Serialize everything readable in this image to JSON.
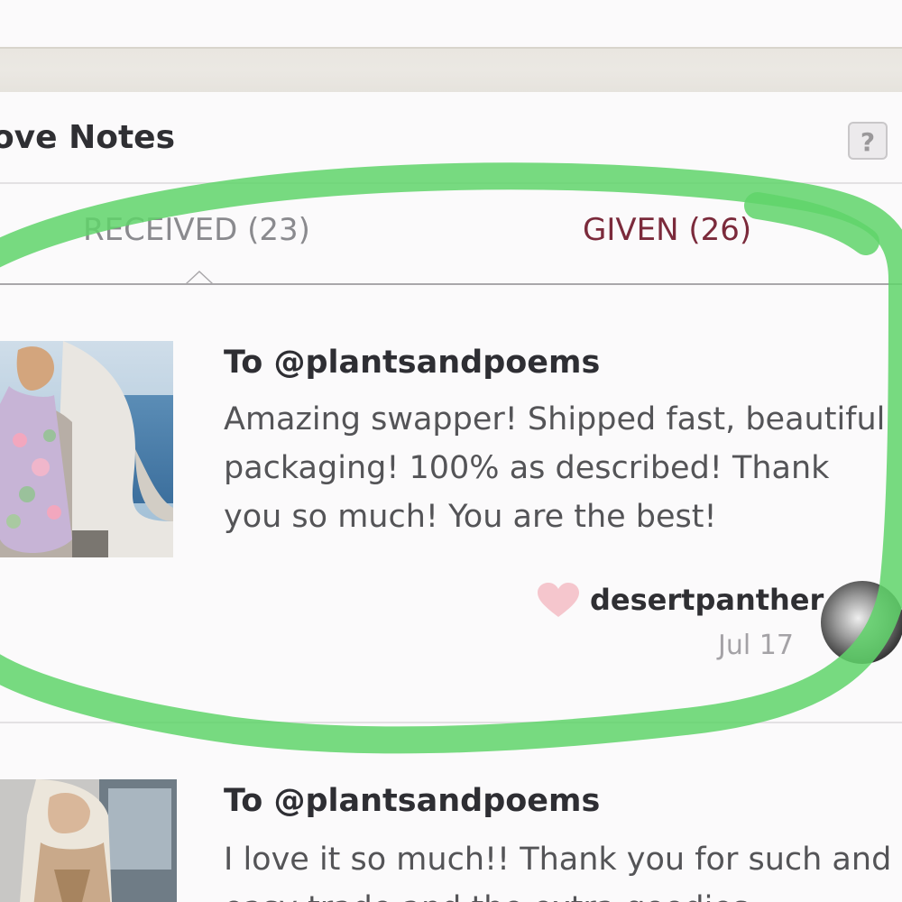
{
  "header": {
    "title": "Love Notes",
    "help_label": "?"
  },
  "tabs": [
    {
      "label": "RECEIVED",
      "count": "(23)",
      "selected": true
    },
    {
      "label": "GIVEN",
      "count": "(26)",
      "selected": false
    }
  ],
  "notes": [
    {
      "recipient": "To @plantsandpoems",
      "message": "Amazing swapper! Shipped fast, beautiful packaging! 100% as described! Thank you so much! You are the best!",
      "sender": "desertpanther",
      "date": "Jul 17"
    },
    {
      "recipient": "To @plantsandpoems",
      "message": "I love it so much!! Thank you for such and easy trade and the extra goodies"
    }
  ],
  "colors": {
    "accent_given": "#7b2a3b",
    "heart": "#f5c6cd",
    "annotation_stroke": "#5fd36a"
  }
}
